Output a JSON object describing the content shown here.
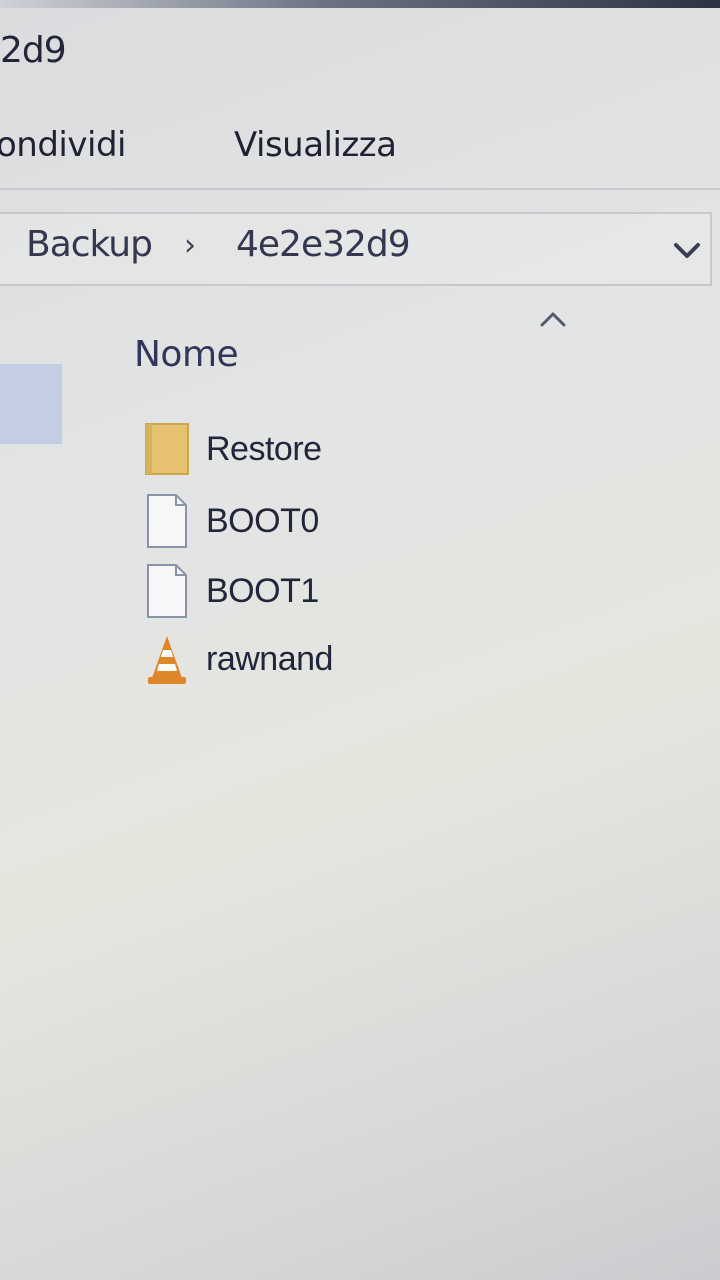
{
  "window": {
    "title": "2d9"
  },
  "ribbon": {
    "tabs": [
      {
        "label": "ondividi"
      },
      {
        "label": "Visualizza"
      }
    ]
  },
  "address_bar": {
    "breadcrumbs": [
      {
        "label": "Backup"
      },
      {
        "label": "4e2e32d9"
      }
    ],
    "separator": "›",
    "dropdown_icon": "chevron-down-icon"
  },
  "file_list": {
    "column_header": "Nome",
    "sort_icon": "chevron-up-icon",
    "items": [
      {
        "name": "Restore",
        "icon": "folder-icon"
      },
      {
        "name": "BOOT0",
        "icon": "file-icon"
      },
      {
        "name": "BOOT1",
        "icon": "file-icon"
      },
      {
        "name": "rawnand",
        "icon": "vlc-cone-icon"
      }
    ]
  },
  "colors": {
    "folder": "#e6c270",
    "file_outline": "#8a94a8",
    "vlc_orange": "#e0862a",
    "selection": "#c3cde4"
  }
}
